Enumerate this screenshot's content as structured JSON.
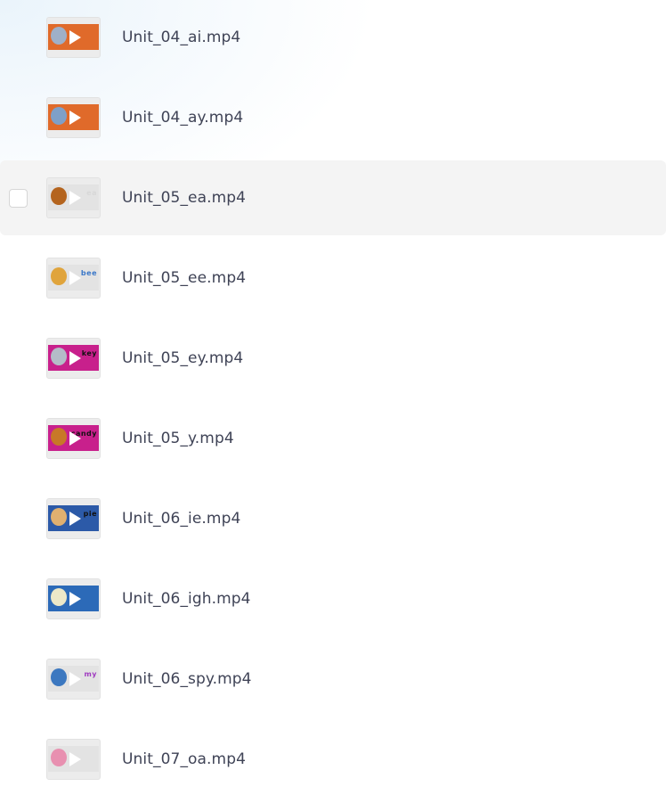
{
  "files": [
    {
      "name": "Unit_04_ai.mp4",
      "thumb_color": "#e06a2a",
      "sprite_color": "#9fb0c8",
      "tag": "",
      "tag_color": ""
    },
    {
      "name": "Unit_04_ay.mp4",
      "thumb_color": "#e06a2a",
      "sprite_color": "#7fa0c8",
      "tag": "",
      "tag_color": ""
    },
    {
      "name": "Unit_05_ea.mp4",
      "thumb_color": "#e3e3e3",
      "sprite_color": "#b4641e",
      "tag": "ea",
      "tag_color": "#d8d8d8",
      "hovered": true
    },
    {
      "name": "Unit_05_ee.mp4",
      "thumb_color": "#e3e3e3",
      "sprite_color": "#e0a43c",
      "tag": "bee",
      "tag_color": "#3c78c8"
    },
    {
      "name": "Unit_05_ey.mp4",
      "thumb_color": "#c8208c",
      "sprite_color": "#b4bcc8",
      "tag": "key",
      "tag_color": "#111111"
    },
    {
      "name": "Unit_05_y.mp4",
      "thumb_color": "#c8208c",
      "sprite_color": "#c87828",
      "tag": "candy",
      "tag_color": "#111111"
    },
    {
      "name": "Unit_06_ie.mp4",
      "thumb_color": "#2c5aa8",
      "sprite_color": "#e0b070",
      "tag": "pie",
      "tag_color": "#111111"
    },
    {
      "name": "Unit_06_igh.mp4",
      "thumb_color": "#2c6ab8",
      "sprite_color": "#ece8c8",
      "tag": "",
      "tag_color": ""
    },
    {
      "name": "Unit_06_spy.mp4",
      "thumb_color": "#e3e3e3",
      "sprite_color": "#3c78c0",
      "tag": "my",
      "tag_color": "#a03cc0"
    },
    {
      "name": "Unit_07_oa.mp4",
      "thumb_color": "#e3e3e3",
      "sprite_color": "#e890b0",
      "tag": "",
      "tag_color": ""
    }
  ]
}
